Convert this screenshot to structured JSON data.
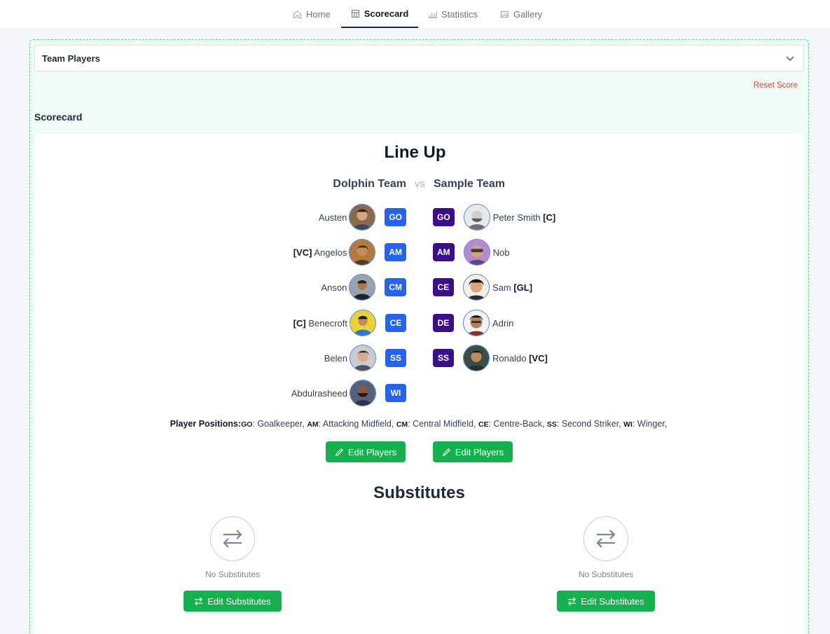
{
  "nav": {
    "tabs": [
      {
        "label": "Home",
        "icon": "home-icon"
      },
      {
        "label": "Scorecard",
        "icon": "scorecard-icon",
        "active": true
      },
      {
        "label": "Statistics",
        "icon": "statistics-icon"
      },
      {
        "label": "Gallery",
        "icon": "gallery-icon"
      }
    ]
  },
  "accordion": {
    "label": "Team Players"
  },
  "actions": {
    "reset_score": "Reset Score"
  },
  "section": {
    "title": "Scorecard"
  },
  "lineup": {
    "title": "Line Up",
    "vs": "VS",
    "team_a": {
      "name": "Dolphin Team",
      "players": [
        {
          "tag": "",
          "name": "Austen",
          "pos": "GO"
        },
        {
          "tag": "[VC]",
          "name": "Angelos",
          "pos": "AM"
        },
        {
          "tag": "",
          "name": "Anson",
          "pos": "CM"
        },
        {
          "tag": "[C]",
          "name": "Benecroft",
          "pos": "CE"
        },
        {
          "tag": "",
          "name": "Belen",
          "pos": "SS"
        },
        {
          "tag": "",
          "name": "Abdulrasheed",
          "pos": "WI"
        }
      ]
    },
    "team_b": {
      "name": "Sample Team",
      "players": [
        {
          "tag": "[C]",
          "name": "Peter Smith",
          "pos": "GO"
        },
        {
          "tag": "",
          "name": "Nob",
          "pos": "AM"
        },
        {
          "tag": "[GL]",
          "name": "Sam",
          "pos": "CE"
        },
        {
          "tag": "",
          "name": "Adrin",
          "pos": "DE"
        },
        {
          "tag": "[VC]",
          "name": "Ronaldo",
          "pos": "SS"
        }
      ]
    },
    "positions_label": "Player Positions:",
    "positions": [
      {
        "code": "GO",
        "desc": "Goalkeeper"
      },
      {
        "code": "AM",
        "desc": "Attacking Midfield"
      },
      {
        "code": "CM",
        "desc": "Central Midfield"
      },
      {
        "code": "CE",
        "desc": "Centre-Back"
      },
      {
        "code": "SS",
        "desc": "Second Striker"
      },
      {
        "code": "WI",
        "desc": "Winger"
      }
    ],
    "edit_players_label": "Edit Players"
  },
  "substitutes": {
    "title": "Substitutes",
    "empty_label": "No Substitutes",
    "edit_label": "Edit Substitutes"
  },
  "colors": {
    "badge_team_a": "#2563eb",
    "badge_team_b": "#3b0f86",
    "primary_button": "#16b14e",
    "reset": "#e03b3b",
    "container_bg": "#effbf4"
  }
}
